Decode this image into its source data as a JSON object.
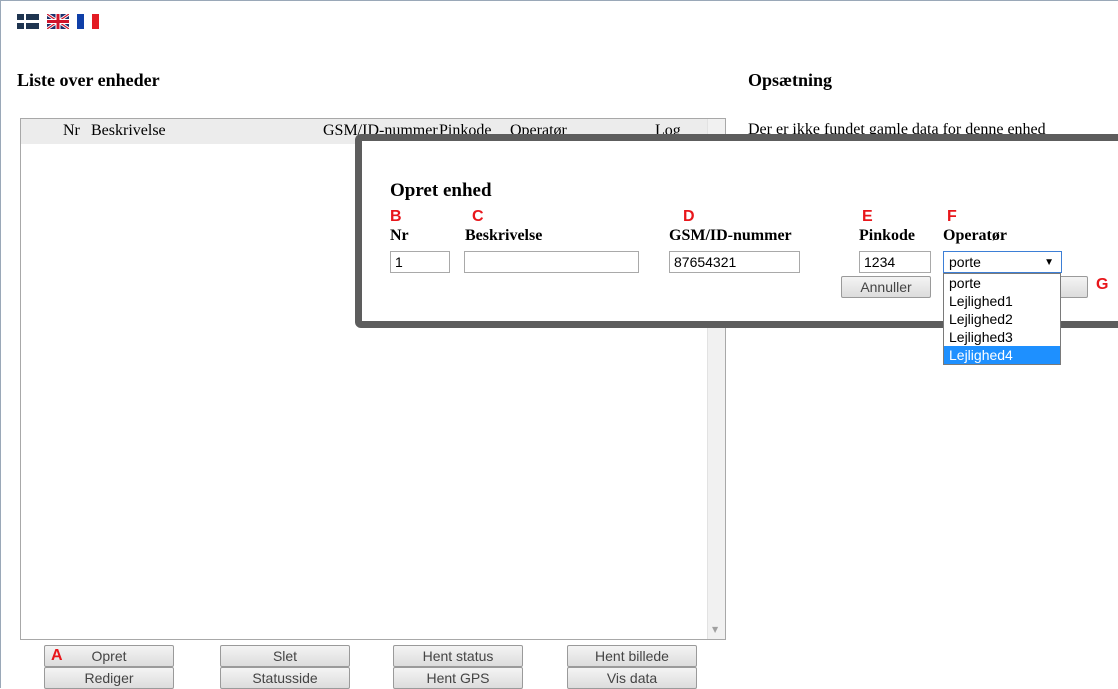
{
  "flags": [
    {
      "icon": "grid-icon"
    },
    {
      "icon": "uk-flag-icon"
    },
    {
      "icon": "france-flag-icon"
    }
  ],
  "list_title": "Liste over enheder",
  "setup_title": "Opsætning",
  "setup_message": "Der er ikke fundet gamle data for denne enhed",
  "list": {
    "columns": [
      "Nr",
      "Beskrivelse",
      "GSM/ID-nummer",
      "Pinkode",
      "Operatør",
      "Log"
    ]
  },
  "buttons": {
    "row1": [
      "Opret",
      "Slet",
      "Hent status",
      "Hent billede"
    ],
    "row2": [
      "Rediger",
      "Statusside",
      "Hent GPS",
      "Vis data"
    ]
  },
  "annotations": {
    "a": "A",
    "b": "B",
    "c": "C",
    "d": "D",
    "e": "E",
    "f": "F",
    "g": "G"
  },
  "modal": {
    "title": "Opret enhed",
    "labels": {
      "nr": "Nr",
      "description": "Beskrivelse",
      "gsm": "GSM/ID-nummer",
      "pin": "Pinkode",
      "operator": "Operatør"
    },
    "values": {
      "nr": "1",
      "description": "",
      "gsm": "87654321",
      "pin": "1234",
      "operator": "porte"
    },
    "cancel_label": "Annuller",
    "operator_options": [
      "porte",
      "Lejlighed1",
      "Lejlighed2",
      "Lejlighed3",
      "Lejlighed4"
    ],
    "highlighted_option": "Lejlighed4"
  },
  "colors": {
    "annotation_red": "#e8161b",
    "dropdown_highlight": "#1e90ff",
    "modal_border": "#5d5d5d"
  }
}
